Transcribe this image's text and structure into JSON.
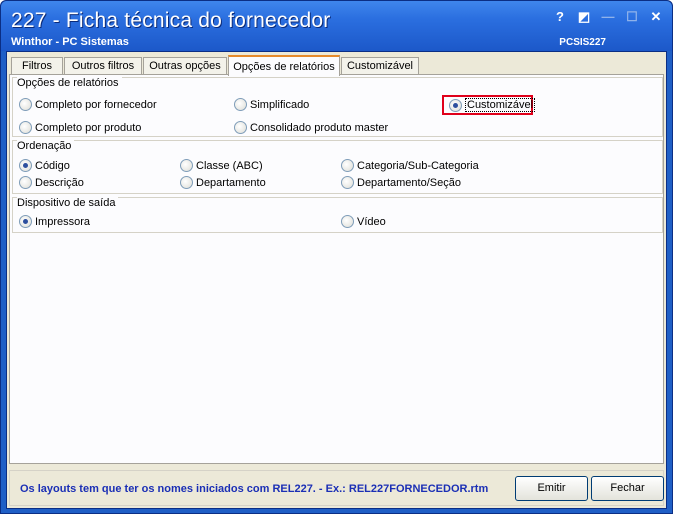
{
  "window": {
    "title": "227 - Ficha técnica do fornecedor",
    "subtitle": "Winthor - PC Sistemas",
    "code": "PCSIS227",
    "controls": [
      "?",
      "◩",
      "—",
      "☐",
      "✕"
    ]
  },
  "tabs": [
    {
      "label": "Filtros",
      "active": false
    },
    {
      "label": "Outros filtros",
      "active": false
    },
    {
      "label": "Outras opções",
      "active": false
    },
    {
      "label": "Opções de relatórios",
      "active": true
    },
    {
      "label": "Customizável",
      "active": false
    }
  ],
  "report_options": {
    "title": "Opções de relatórios",
    "items": [
      {
        "label": "Completo por fornecedor",
        "checked": false
      },
      {
        "label": "Simplificado",
        "checked": false
      },
      {
        "label": "Customizável",
        "checked": true
      },
      {
        "label": "Completo por produto",
        "checked": false
      },
      {
        "label": "Consolidado produto master",
        "checked": false
      }
    ]
  },
  "ordering": {
    "title": "Ordenação",
    "items": [
      {
        "label": "Código",
        "checked": true
      },
      {
        "label": "Classe (ABC)",
        "checked": false
      },
      {
        "label": "Categoria/Sub-Categoria",
        "checked": false
      },
      {
        "label": "Descrição",
        "checked": false
      },
      {
        "label": "Departamento",
        "checked": false
      },
      {
        "label": "Departamento/Seção",
        "checked": false
      }
    ]
  },
  "output_device": {
    "title": "Dispositivo de saída",
    "items": [
      {
        "label": "Impressora",
        "checked": true
      },
      {
        "label": "Vídeo",
        "checked": false
      }
    ]
  },
  "footer": {
    "info": "Os layouts tem que ter os nomes iniciados com REL227.  - Ex.: REL227FORNECEDOR.rtm",
    "emit_label": "Emitir",
    "close_label": "Fechar"
  },
  "colors": {
    "titlebar": "#2b6fe0",
    "info_text": "#1b2fb5",
    "highlight": "#e0001b",
    "active_tab_accent": "#e68b2c"
  }
}
